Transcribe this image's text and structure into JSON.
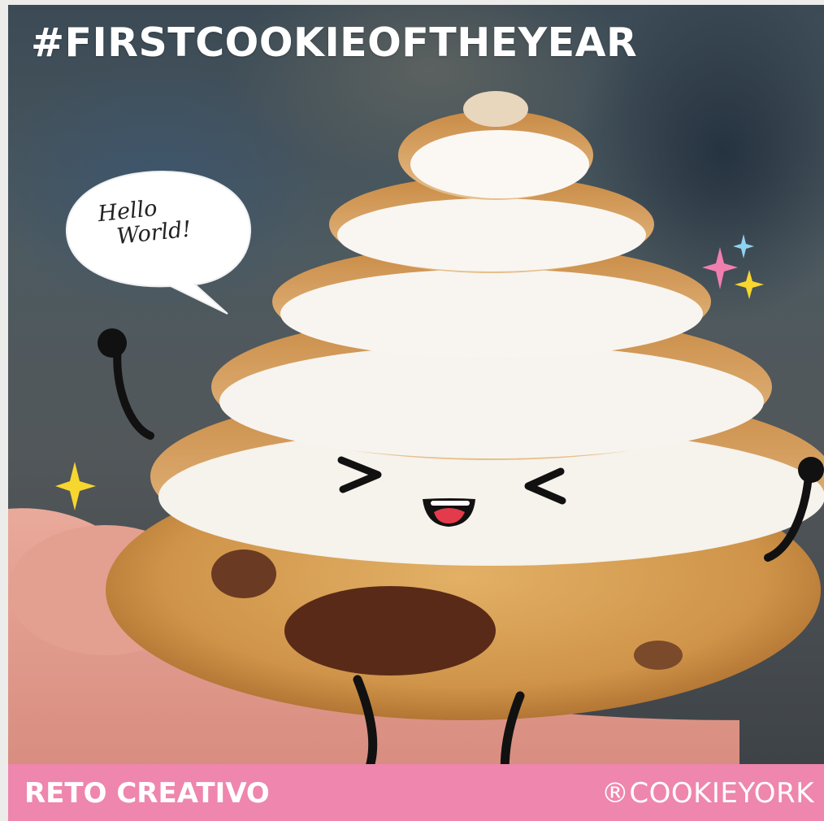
{
  "image": {
    "title": "#FIRSTCOOKIEOFTHEYEAR",
    "speech_bubble": {
      "line1": "Hello",
      "line2": "World!"
    },
    "banner": {
      "left": "RETO CREATIVO",
      "right": "®COOKIEYORK"
    },
    "colors": {
      "banner": "#ee86ad",
      "meringue": "#f6f2ec",
      "toast": "#c88a45",
      "cookie": "#d9a45b",
      "sparkle_yellow": "#f7d630",
      "sparkle_pink": "#f07fb0",
      "sparkle_blue": "#8fd3f0"
    }
  }
}
